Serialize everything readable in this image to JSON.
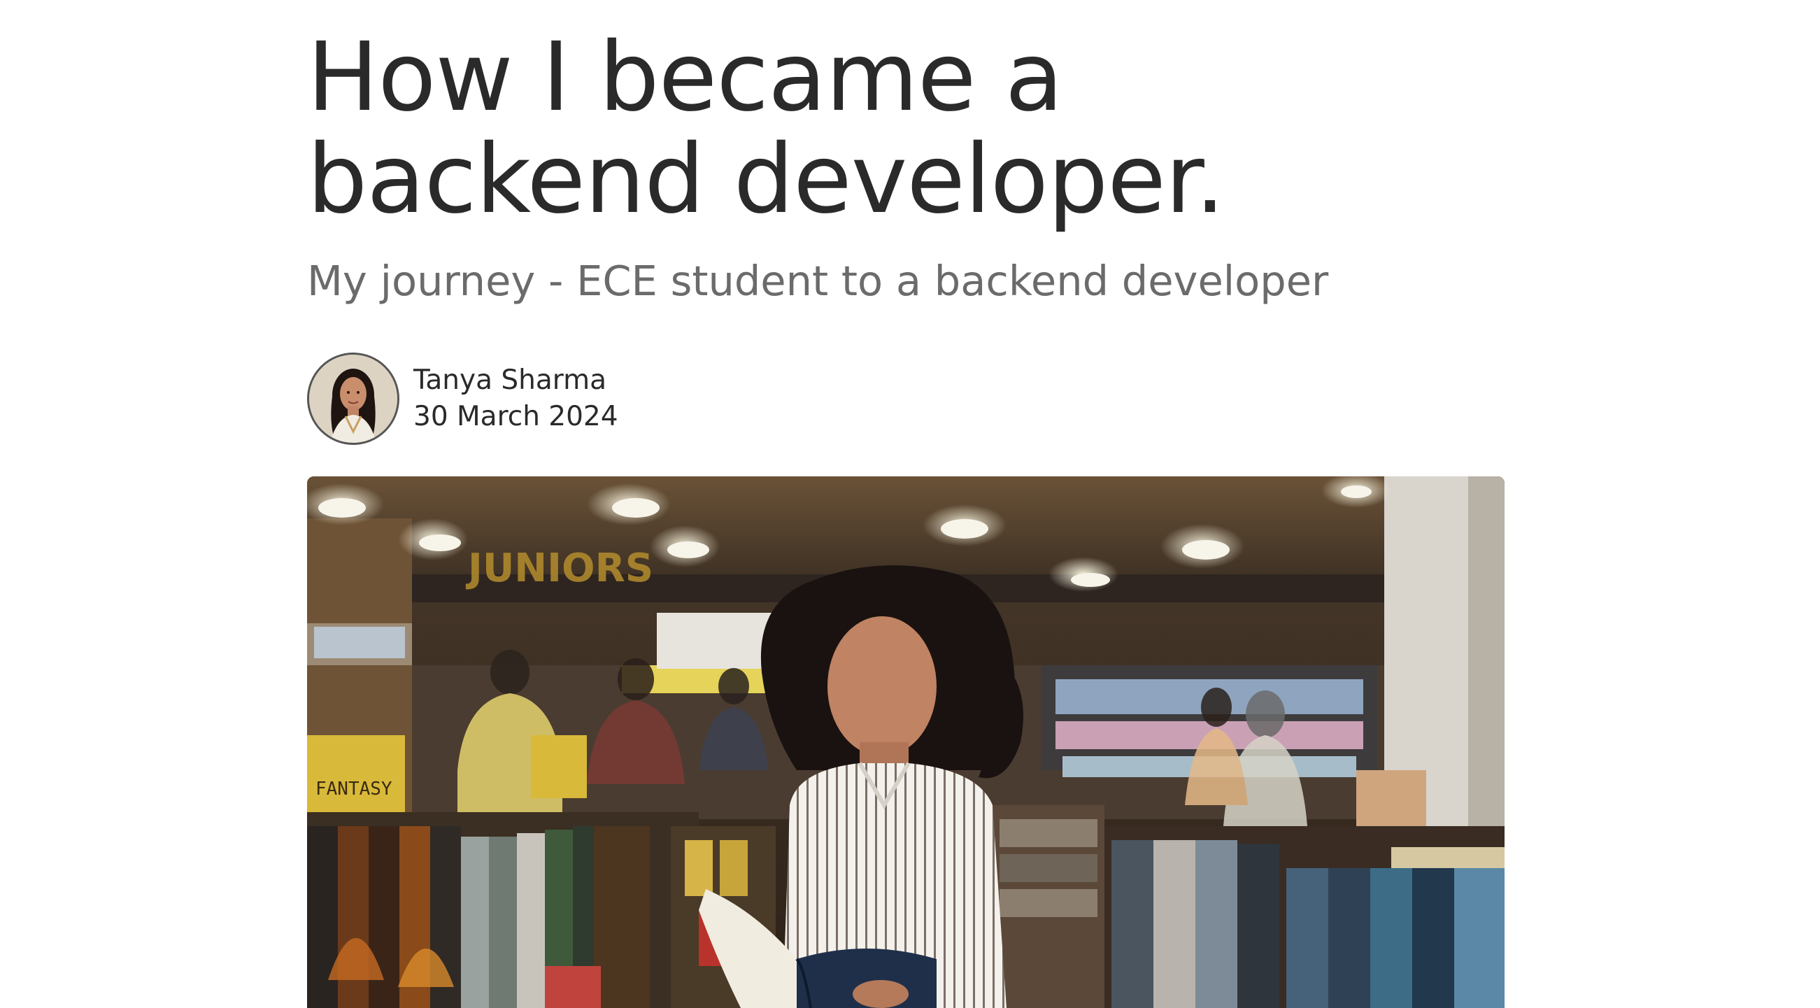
{
  "article": {
    "title_line1": "How I became a",
    "title_line2": "backend developer.",
    "subtitle": "My journey - ECE student to a backend developer"
  },
  "author": {
    "name": "Tanya Sharma",
    "date": "30 March 2024",
    "avatar_icon": "author-portrait"
  },
  "hero": {
    "description_icon": "bookstore-photo",
    "sign_text": "JUNIORS",
    "shelf_label": "FANTASY"
  }
}
